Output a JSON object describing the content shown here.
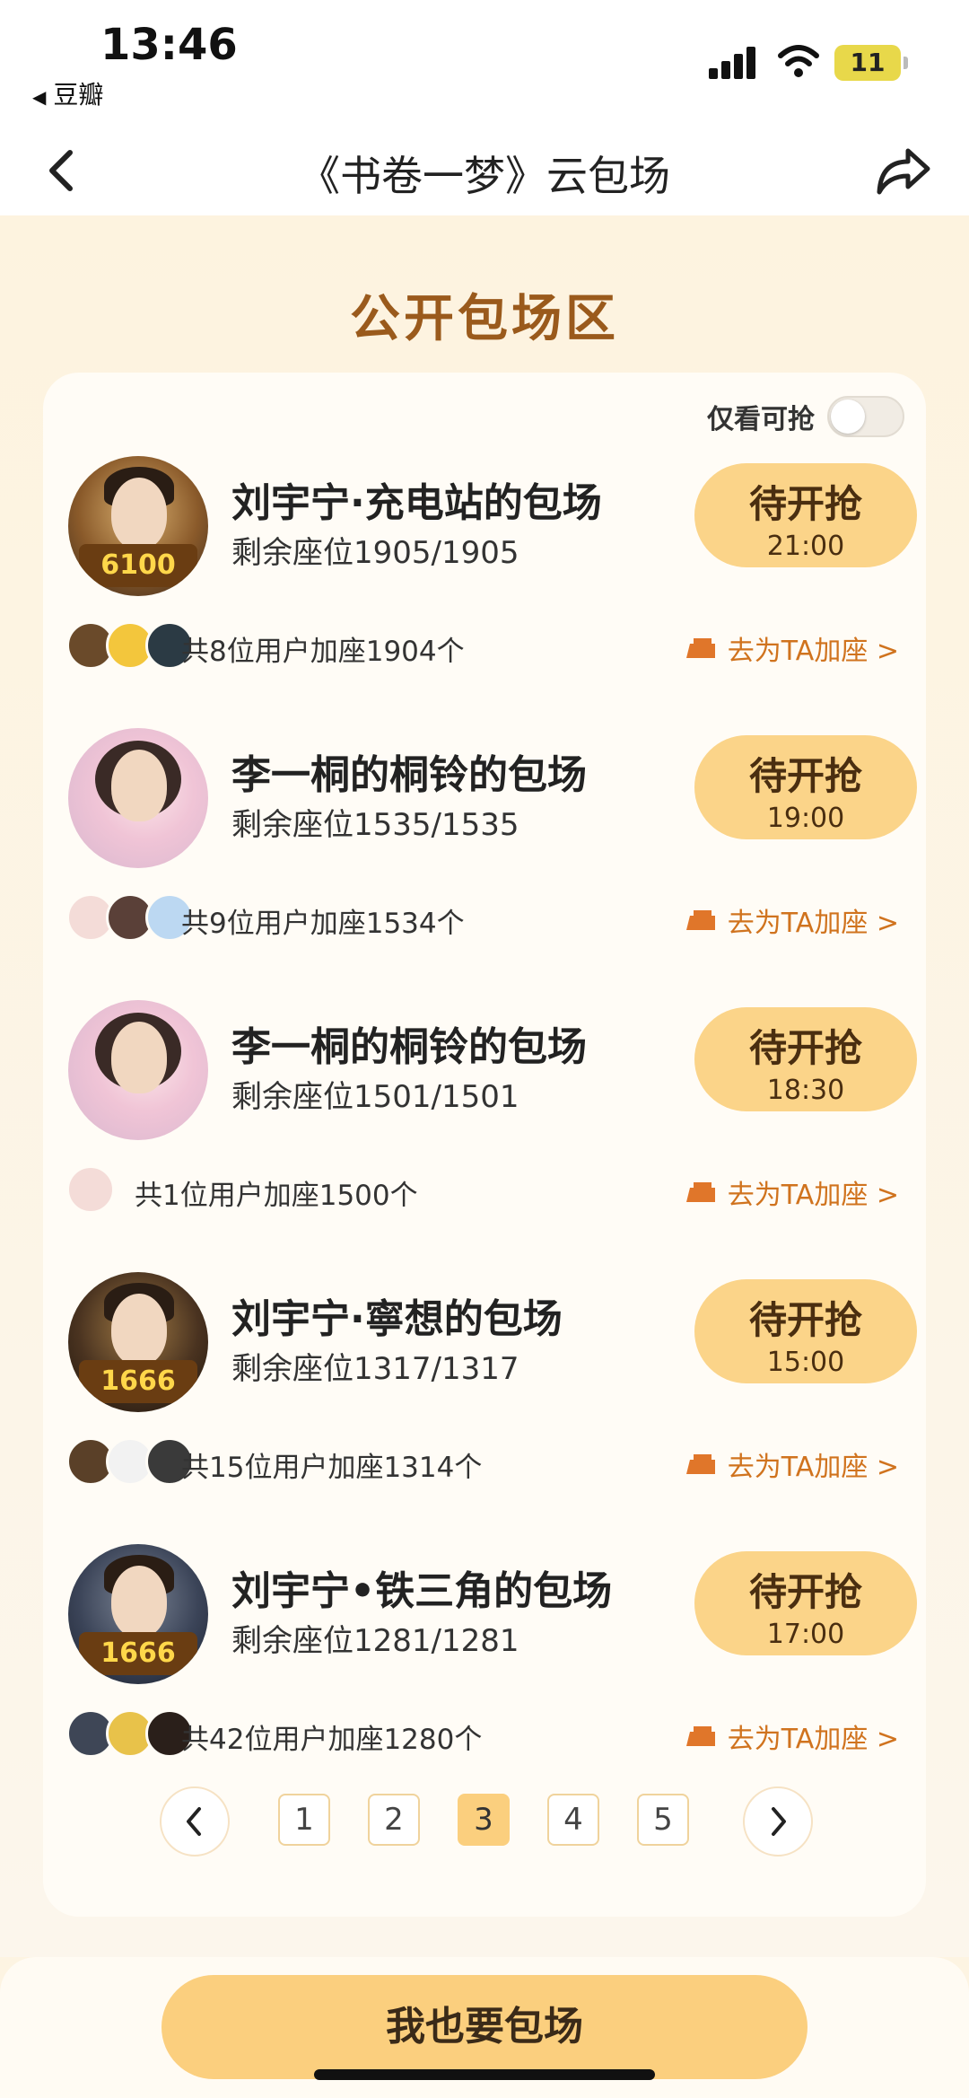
{
  "status_bar": {
    "time": "13:46",
    "back_app": "豆瓣",
    "battery": "11"
  },
  "nav": {
    "title": "《书卷一梦》云包场"
  },
  "section_title": "公开包场区",
  "filter": {
    "label": "仅看可抢",
    "enabled": false
  },
  "items": [
    {
      "title": "刘宇宁·充电站的包场",
      "seats": "剩余座位1905/1905",
      "status": "待开抢",
      "time": "21:00",
      "users": "共8位用户加座1904个",
      "add_label": "去为TA加座 >",
      "banner": "6100",
      "avatar_count": 3
    },
    {
      "title": "李一桐的桐铃的包场",
      "seats": "剩余座位1535/1535",
      "status": "待开抢",
      "time": "19:00",
      "users": "共9位用户加座1534个",
      "add_label": "去为TA加座 >",
      "banner": "",
      "avatar_count": 3
    },
    {
      "title": "李一桐的桐铃的包场",
      "seats": "剩余座位1501/1501",
      "status": "待开抢",
      "time": "18:30",
      "users": "共1位用户加座1500个",
      "add_label": "去为TA加座 >",
      "banner": "",
      "avatar_count": 1
    },
    {
      "title": "刘宇宁·寧想的包场",
      "seats": "剩余座位1317/1317",
      "status": "待开抢",
      "time": "15:00",
      "users": "共15位用户加座1314个",
      "add_label": "去为TA加座 >",
      "banner": "1666",
      "avatar_count": 3
    },
    {
      "title": "刘宇宁•铁三角的包场",
      "seats": "剩余座位1281/1281",
      "status": "待开抢",
      "time": "17:00",
      "users": "共42位用户加座1280个",
      "add_label": "去为TA加座 >",
      "banner": "1666",
      "avatar_count": 3
    }
  ],
  "pagination": {
    "pages": [
      "1",
      "2",
      "3",
      "4",
      "5"
    ],
    "current": "3"
  },
  "cta": {
    "label": "我也要包场"
  },
  "colors": {
    "accent": "#fbcf7e",
    "title_brown": "#9a5a1c",
    "link_orange": "#d0731e"
  }
}
